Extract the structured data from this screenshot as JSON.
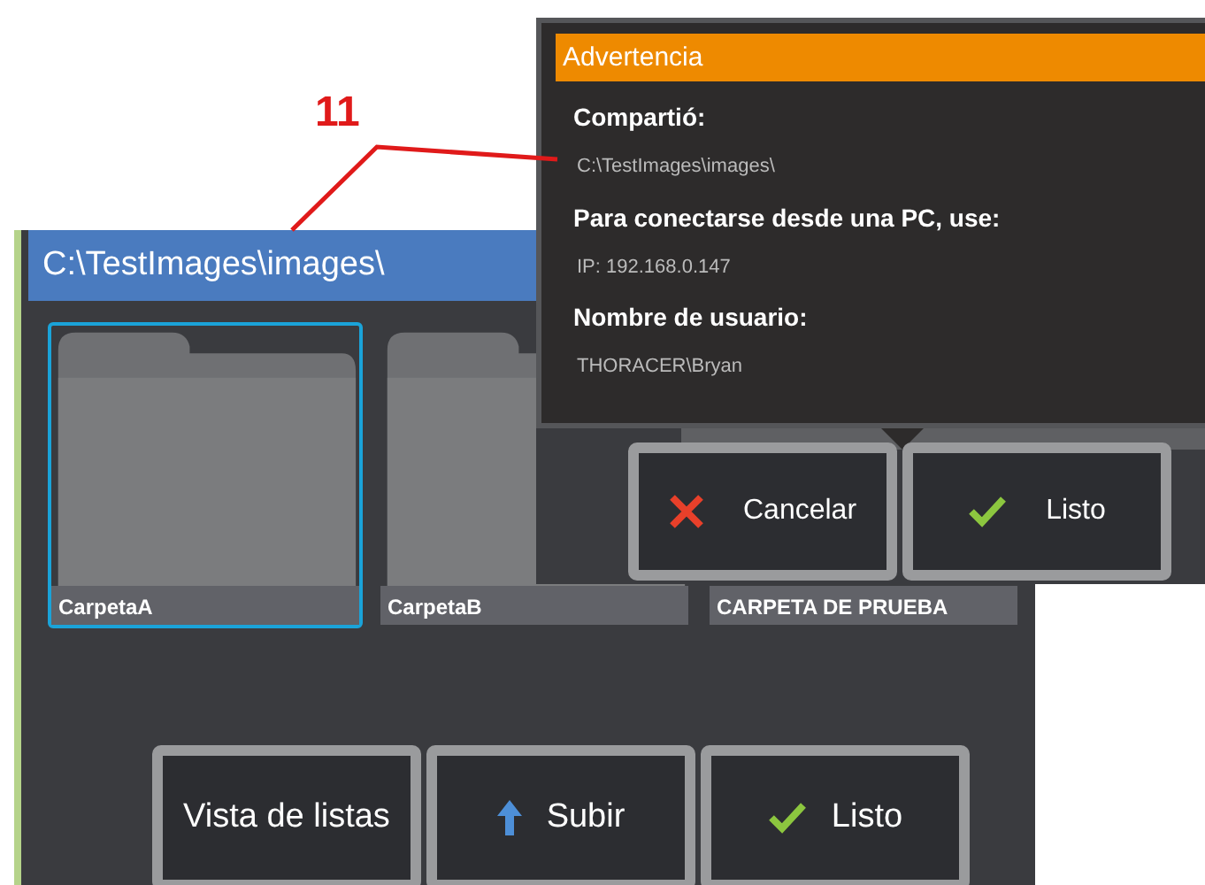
{
  "callout": {
    "label": "11"
  },
  "window": {
    "title": "C:\\TestImages\\images\\"
  },
  "folders": [
    {
      "name": "CarpetaA",
      "selected": true,
      "kind": "folder"
    },
    {
      "name": "CarpetaB",
      "selected": false,
      "kind": "folder"
    },
    {
      "name": "CARPETA DE PRUEBA",
      "selected": false,
      "kind": "covered"
    }
  ],
  "buttons": [
    {
      "label": "Vista de listas",
      "kind": "text"
    },
    {
      "label": "Subir",
      "kind": "up"
    },
    {
      "label": "Listo",
      "kind": "check"
    }
  ],
  "dialog": {
    "title": "Advertencia",
    "fields": [
      {
        "label": "Compartió:",
        "value": "C:\\TestImages\\images\\"
      },
      {
        "label": "Para conectarse desde una PC, use:",
        "value": "IP: 192.168.0.147"
      },
      {
        "label": "Nombre de usuario:",
        "value": "THORACER\\Bryan"
      }
    ],
    "buttons": [
      {
        "label": "Cancelar",
        "kind": "cancel"
      },
      {
        "label": "Listo",
        "kind": "check"
      }
    ]
  }
}
